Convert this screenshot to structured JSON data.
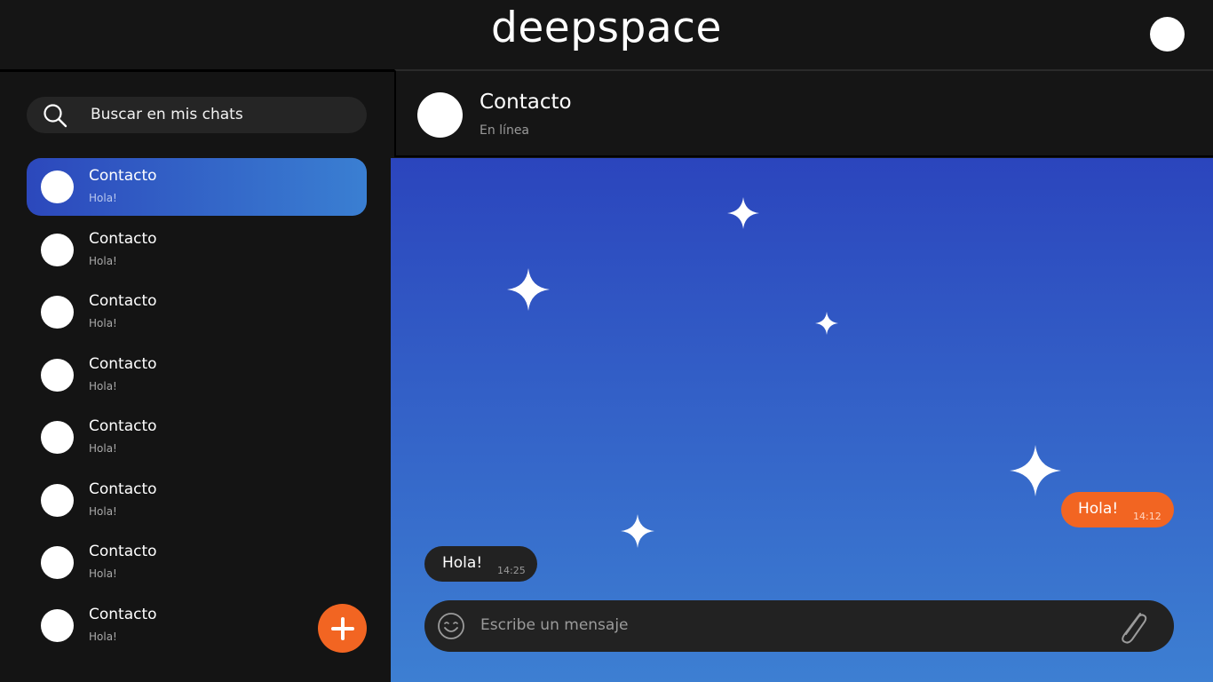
{
  "app": {
    "brand": "deepspace"
  },
  "search": {
    "placeholder": "Buscar en mis chats",
    "icon": "search-icon"
  },
  "chats": [
    {
      "name": "Contacto",
      "preview": "Hola!",
      "active": true
    },
    {
      "name": "Contacto",
      "preview": "Hola!"
    },
    {
      "name": "Contacto",
      "preview": "Hola!"
    },
    {
      "name": "Contacto",
      "preview": "Hola!"
    },
    {
      "name": "Contacto",
      "preview": "Hola!"
    },
    {
      "name": "Contacto",
      "preview": "Hola!"
    },
    {
      "name": "Contacto",
      "preview": "Hola!"
    },
    {
      "name": "Contacto",
      "preview": "Hola!"
    }
  ],
  "new_chat_button": {
    "icon": "plus-icon"
  },
  "conversation": {
    "contact_name": "Contacto",
    "status": "En línea",
    "messages": [
      {
        "direction": "outgoing",
        "text": "Hola!",
        "time": "14:12"
      },
      {
        "direction": "incoming",
        "text": "Hola!",
        "time": "14:25"
      }
    ]
  },
  "composer": {
    "placeholder": "Escribe un mensaje",
    "emoji_icon": "emoji-icon",
    "attach_icon": "paperclip-icon"
  },
  "colors": {
    "accent": "#f26522",
    "gradient_top": "#2b45bd",
    "gradient_bottom": "#3d7fd2",
    "background": "#141414"
  }
}
